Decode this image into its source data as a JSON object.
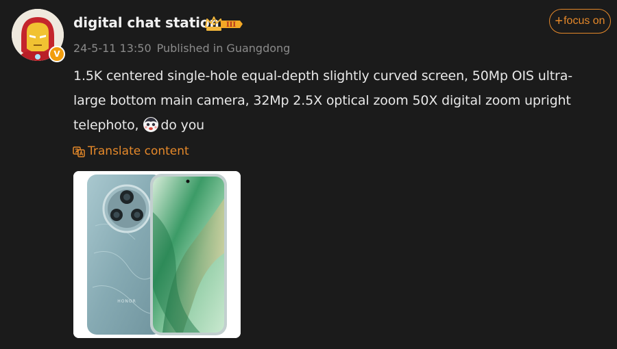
{
  "post": {
    "username": "digital chat station",
    "verified_badge": "V",
    "level_badge": "III",
    "timestamp": "24-5-11 13:50",
    "location": "Published in Guangdong",
    "follow_label": "focus on",
    "body_text_before_emoji": "1.5K centered single-hole equal-depth slightly curved screen, 50Mp OIS ultra-large bottom main camera, 32Mp 2.5X optical zoom 50X digital zoom upright telephoto,",
    "body_text_after_emoji": "do you",
    "translate_label": "Translate content",
    "image_brand_text": "HONOR"
  },
  "colors": {
    "background": "#1b1b1b",
    "accent_orange": "#e6892a",
    "text_primary": "#e8e8e8",
    "text_secondary": "#8b8b8b"
  },
  "icons": [
    "iron-man-avatar",
    "verified-v-icon",
    "crown-level-icon",
    "plus-icon",
    "emoji-icon",
    "translate-icon"
  ]
}
